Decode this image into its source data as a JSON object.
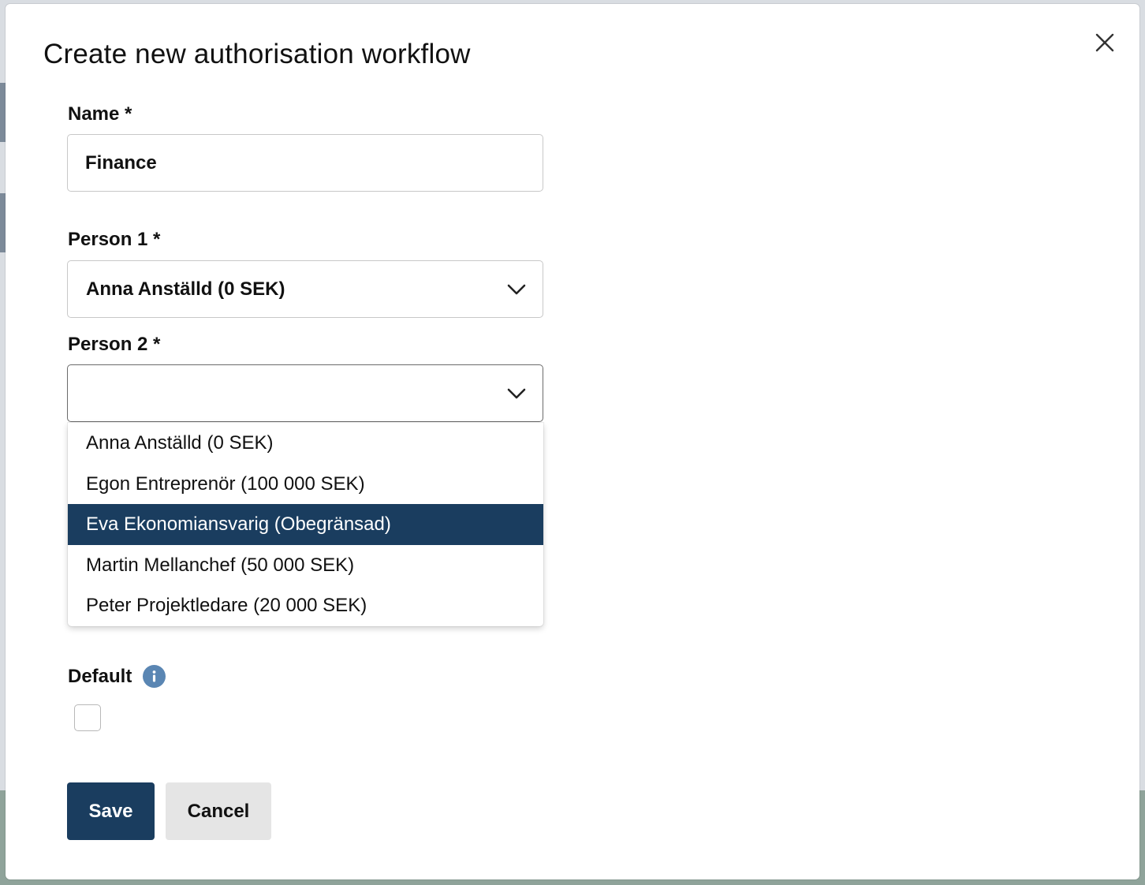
{
  "dialog": {
    "title": "Create new authorisation workflow"
  },
  "form": {
    "name_label": "Name *",
    "name_value": "Finance",
    "person1_label": "Person 1 *",
    "person1_value": "Anna Anställd (0 SEK)",
    "person2_label": "Person 2 *",
    "person2_value": "",
    "person2_options": [
      "Anna Anställd (0 SEK)",
      "Egon Entreprenör (100 000 SEK)",
      "Eva Ekonomiansvarig (Obegränsad)",
      "Martin Mellanchef (50 000 SEK)",
      "Peter Projektledare (20 000 SEK)"
    ],
    "person2_highlighted_option": "Eva Ekonomiansvarig (Obegränsad)",
    "default_label": "Default",
    "default_checked": false
  },
  "buttons": {
    "save": "Save",
    "cancel": "Cancel"
  },
  "colors": {
    "primary": "#1a3d5f",
    "info_icon": "#5a86b3",
    "secondary_button": "#e5e5e5"
  },
  "icons": {
    "close": "close-icon",
    "chevron": "chevron-down-icon",
    "info": "info-icon"
  }
}
